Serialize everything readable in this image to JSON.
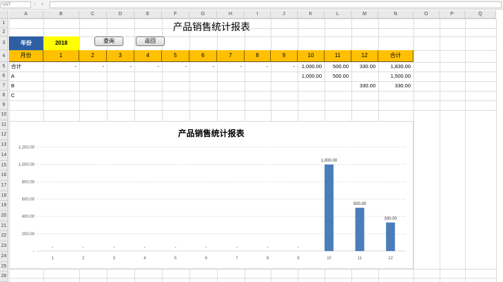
{
  "formula_bar": {
    "name_box": "U17",
    "separators": "⁝ × ✓",
    "content": ""
  },
  "columns": [
    "A",
    "B",
    "C",
    "D",
    "E",
    "F",
    "G",
    "H",
    "I",
    "J",
    "K",
    "L",
    "M",
    "N",
    "O",
    "P",
    "Q"
  ],
  "rows_top": [
    "1",
    "2",
    "3",
    "4",
    "5",
    "6",
    "7",
    "8",
    "9"
  ],
  "rows_chart": [
    "10",
    "11",
    "12",
    "13",
    "14",
    "15",
    "16",
    "17",
    "18",
    "19",
    "20",
    "21",
    "22",
    "23",
    "24",
    "25",
    "26"
  ],
  "sheet_title": "产品销售统计报表",
  "year": {
    "label": "年份",
    "value": "2018"
  },
  "buttons": {
    "query": "查询",
    "back": "返回"
  },
  "table": {
    "header": [
      "月份",
      "1",
      "2",
      "3",
      "4",
      "5",
      "6",
      "7",
      "8",
      "9",
      "10",
      "11",
      "12",
      "合计"
    ],
    "rows": [
      {
        "label": "合计",
        "cells": [
          "-",
          "-",
          "-",
          "-",
          "-",
          "-",
          "-",
          "-",
          "-",
          "1,000.00",
          "500.00",
          "330.00",
          "1,830.00"
        ]
      },
      {
        "label": "A",
        "cells": [
          "",
          "",
          "",
          "",
          "",
          "",
          "",
          "",
          "",
          "1,000.00",
          "500.00",
          "",
          "1,500.00"
        ]
      },
      {
        "label": "B",
        "cells": [
          "",
          "",
          "",
          "",
          "",
          "",
          "",
          "",
          "",
          "",
          "",
          "330.00",
          "330.00"
        ]
      },
      {
        "label": "C",
        "cells": [
          "",
          "",
          "",
          "",
          "",
          "",
          "",
          "",
          "",
          "",
          "",
          "",
          ""
        ]
      }
    ]
  },
  "colors": {
    "header_fill": "#ffc000",
    "year_label_fill": "#2e5fa3",
    "year_value_fill": "#ffff00",
    "bar": "#4a7ebb"
  },
  "chart_data": {
    "type": "bar",
    "title": "产品销售统计报表",
    "categories": [
      "1",
      "2",
      "3",
      "4",
      "5",
      "6",
      "7",
      "8",
      "9",
      "10",
      "11",
      "12"
    ],
    "values": [
      0,
      0,
      0,
      0,
      0,
      0,
      0,
      0,
      0,
      1000,
      500,
      330
    ],
    "data_labels": [
      "-",
      "-",
      "-",
      "-",
      "-",
      "-",
      "-",
      "-",
      "-",
      "1,000.00",
      "500.00",
      "330.00"
    ],
    "yticks": [
      "-",
      "200.00",
      "400.00",
      "600.00",
      "800.00",
      "1,000.00",
      "1,200.00"
    ],
    "ylim": [
      0,
      1200
    ],
    "grid": true,
    "legend": "none"
  }
}
